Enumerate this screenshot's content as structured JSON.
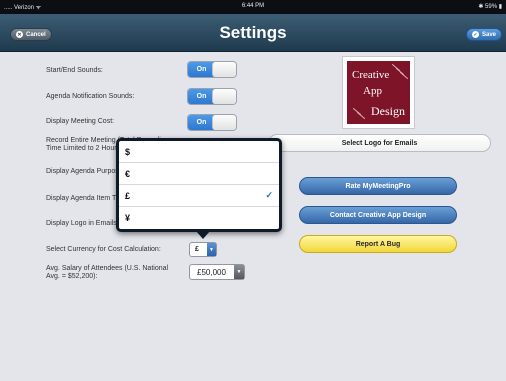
{
  "status_bar": {
    "carrier": "..... Verizon ᯤ",
    "time": "6:44 PM",
    "battery": "✱ 59% ▮"
  },
  "nav": {
    "title": "Settings",
    "cancel_label": "Cancel",
    "save_label": "Save"
  },
  "settings": {
    "start_end_sounds": {
      "label": "Start/End Sounds:",
      "value": "On"
    },
    "agenda_notification_sounds": {
      "label": "Agenda Notification Sounds:",
      "value": "On"
    },
    "display_meeting_cost": {
      "label": "Display Meeting Cost:",
      "value": "On"
    },
    "record_meeting": {
      "label_line1": "Record Entire Meeting (Total Recording",
      "label_line2": "Time Limited to 2 Hours):"
    },
    "display_agenda_purpose": {
      "label": "Display Agenda Purpose:"
    },
    "display_agenda_item": {
      "label": "Display Agenda Item Time:"
    },
    "display_logo_email": {
      "label": "Display Logo in Emails:"
    },
    "currency": {
      "label": "Select Currency for Cost Calculation:",
      "value": "£"
    },
    "salary": {
      "label_line1": "Avg. Salary of Attendees (U.S. National",
      "label_line2": "Avg. = $52,200):",
      "value": "£50,000"
    }
  },
  "logo": {
    "line1": "Creative",
    "line2": "App",
    "line3": "Design"
  },
  "buttons": {
    "select_logo": "Select Logo for Emails",
    "rate": "Rate MyMeetingPro",
    "contact": "Contact Creative App Design",
    "report_bug": "Report A Bug"
  },
  "currency_popover": {
    "options": [
      {
        "symbol": "$",
        "selected": false
      },
      {
        "symbol": "€",
        "selected": false
      },
      {
        "symbol": "£",
        "selected": true
      },
      {
        "symbol": "¥",
        "selected": false
      }
    ],
    "checkmark": "✓"
  }
}
